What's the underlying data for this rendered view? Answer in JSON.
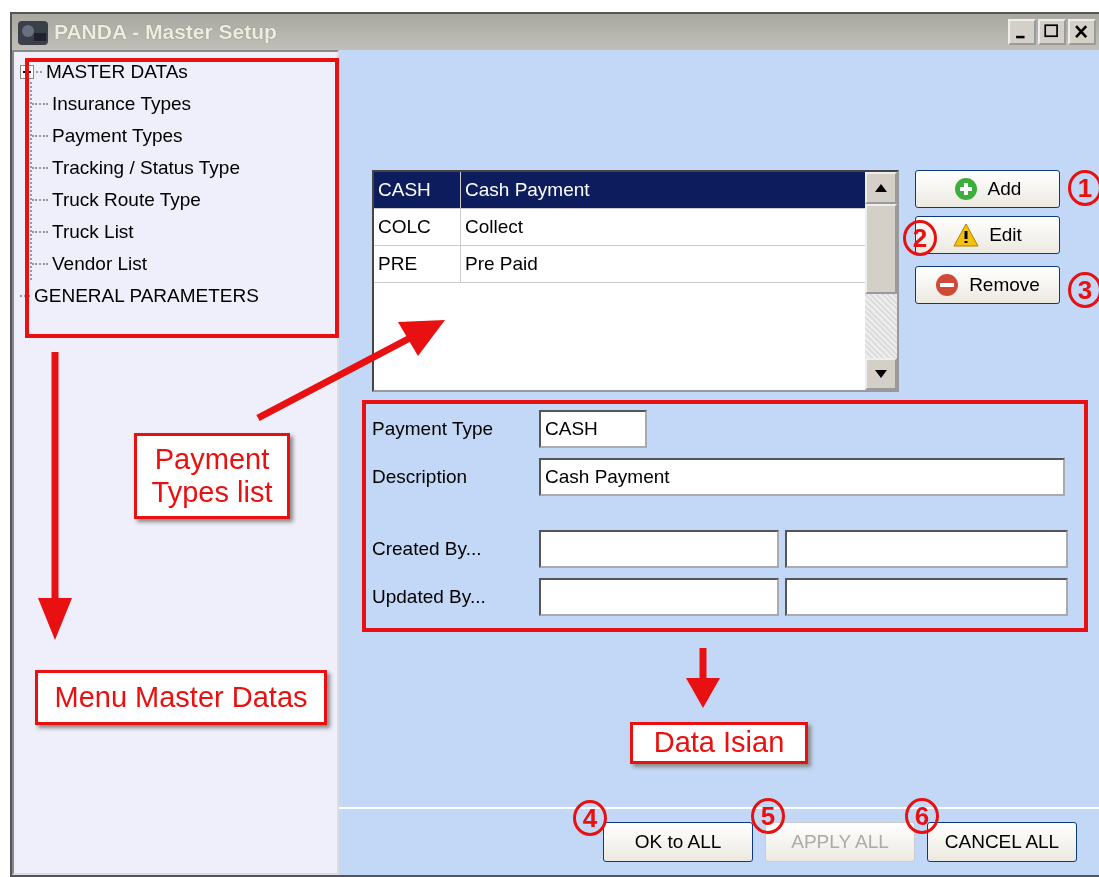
{
  "window": {
    "title": "PANDA - Master Setup"
  },
  "tree": [
    {
      "label": "MASTER DATAs",
      "expanded": true,
      "children": [
        {
          "label": "Insurance Types"
        },
        {
          "label": "Payment Types"
        },
        {
          "label": "Tracking / Status Type"
        },
        {
          "label": "Truck Route Type"
        },
        {
          "label": "Truck List"
        },
        {
          "label": "Vendor List"
        }
      ]
    },
    {
      "label": "GENERAL PARAMETERS"
    }
  ],
  "list": {
    "rows": [
      {
        "code": "CASH",
        "description": "Cash Payment",
        "selected": true
      },
      {
        "code": "COLC",
        "description": "Collect",
        "selected": false
      },
      {
        "code": "PRE",
        "description": "Pre Paid",
        "selected": false
      }
    ]
  },
  "side_buttons": [
    {
      "kind": "add",
      "label": "Add"
    },
    {
      "kind": "edit",
      "label": "Edit"
    },
    {
      "kind": "remove",
      "label": "Remove"
    }
  ],
  "form": {
    "payment_type": {
      "label": "Payment Type",
      "value": "CASH"
    },
    "description": {
      "label": "Description",
      "value": "Cash Payment"
    },
    "created_by": {
      "label": "Created By..."
    },
    "updated_by": {
      "label": "Updated By..."
    }
  },
  "bottom_buttons": [
    {
      "label": "OK to ALL",
      "disabled": false
    },
    {
      "label": "APPLY ALL",
      "disabled": true
    },
    {
      "label": "CANCEL ALL",
      "disabled": false
    }
  ],
  "annotations": {
    "labels": [
      "Payment Types list",
      "Menu Master Datas",
      "Data Isian"
    ],
    "markers": [
      "1",
      "2",
      "3",
      "4",
      "5",
      "6"
    ]
  }
}
